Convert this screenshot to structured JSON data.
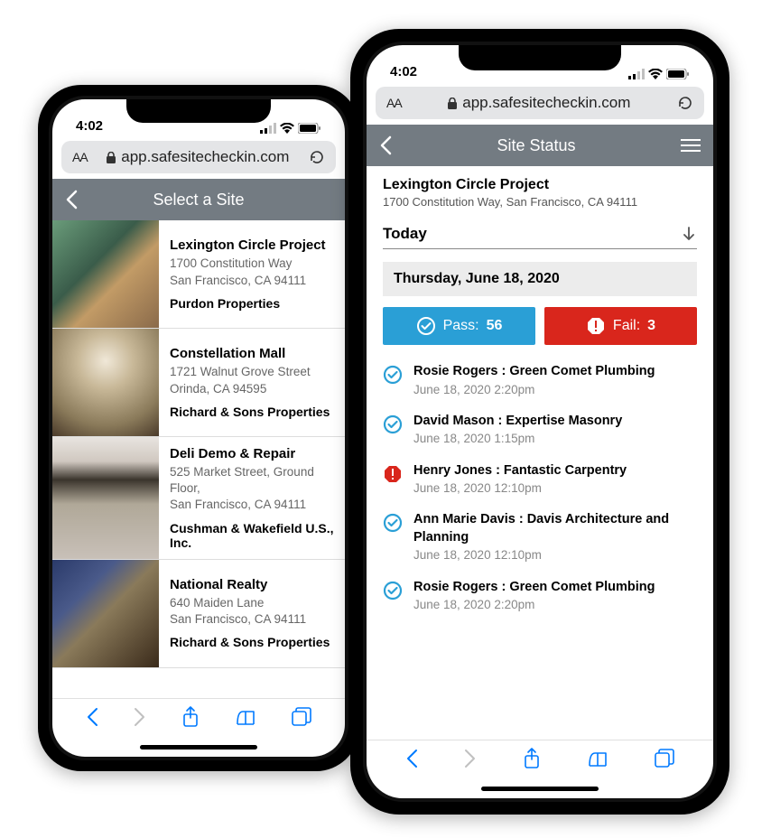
{
  "shared": {
    "time": "4:02",
    "url_aa": "AA",
    "url": "app.safesitecheckin.com"
  },
  "select_site": {
    "title": "Select a Site",
    "sites": [
      {
        "name": "Lexington Circle Project",
        "addr1": "1700 Constitution Way",
        "addr2": "San Francisco, CA 94111",
        "owner": "Purdon Properties"
      },
      {
        "name": "Constellation Mall",
        "addr1": "1721 Walnut Grove Street",
        "addr2": "Orinda, CA 94595",
        "owner": "Richard & Sons Properties"
      },
      {
        "name": "Deli Demo & Repair",
        "addr1": "525 Market Street, Ground Floor,",
        "addr2": "San Francisco, CA 94111",
        "owner": "Cushman & Wakefield U.S., Inc."
      },
      {
        "name": "National Realty",
        "addr1": "640 Maiden Lane",
        "addr2": "San Francisco, CA 94111",
        "owner": "Richard & Sons Properties"
      }
    ]
  },
  "site_status": {
    "title": "Site Status",
    "project_name": "Lexington Circle Project",
    "project_addr": "1700 Constitution Way, San Francisco, CA 94111",
    "today_label": "Today",
    "date": "Thursday, June 18, 2020",
    "pass_label": "Pass:",
    "pass_count": "56",
    "fail_label": "Fail:",
    "fail_count": "3",
    "entries": [
      {
        "status": "pass",
        "name": "Rosie Rogers",
        "company": "Green Comet Plumbing",
        "time": "June 18, 2020 2:20pm"
      },
      {
        "status": "pass",
        "name": "David Mason",
        "company": "Expertise Masonry",
        "time": "June 18, 2020 1:15pm"
      },
      {
        "status": "fail",
        "name": "Henry Jones",
        "company": "Fantastic Carpentry",
        "time": "June 18, 2020 12:10pm"
      },
      {
        "status": "pass",
        "name": "Ann Marie Davis",
        "company": "Davis Architecture and Planning",
        "time": "June 18, 2020 12:10pm"
      },
      {
        "status": "pass",
        "name": "Rosie Rogers",
        "company": "Green Comet Plumbing",
        "time": "June 18, 2020 2:20pm"
      }
    ]
  }
}
